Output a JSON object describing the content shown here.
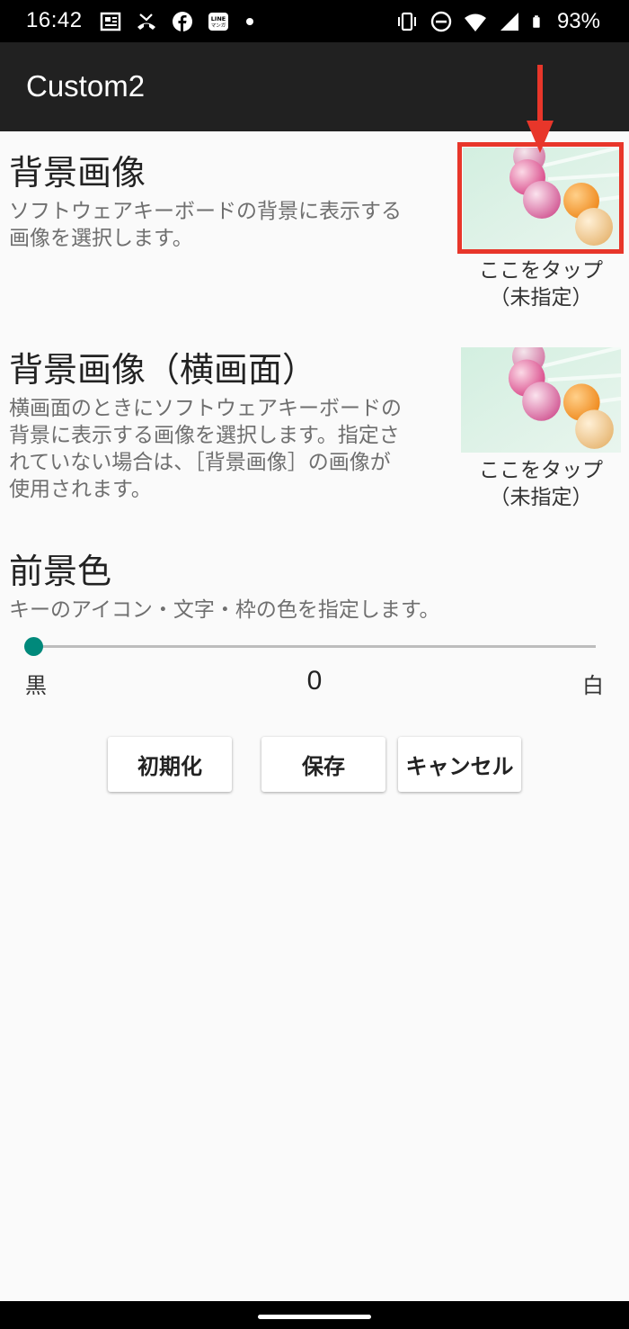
{
  "status_bar": {
    "time": "16:42",
    "left_icons": [
      "news-icon",
      "missed-call-icon",
      "facebook-icon",
      "line-manga-icon",
      "notification-dot-icon"
    ],
    "right_icons": [
      "vibrate-icon",
      "do-not-disturb-icon",
      "wifi-icon",
      "signal-icon",
      "battery-icon"
    ],
    "battery_percent": "93%"
  },
  "app_bar": {
    "title": "Custom2"
  },
  "background_image": {
    "title": "背景画像",
    "summary_line1": "ソフトウェアキーボードの背景に表示する",
    "summary_line2": "画像を選択します。",
    "caption_line1": "ここをタップ",
    "caption_line2": "（未指定）"
  },
  "background_image_landscape": {
    "title": "背景画像（横画面）",
    "summary_line1": "横画面のときにソフトウェアキーボードの",
    "summary_line2": "背景に表示する画像を選択します。指定さ",
    "summary_line3": "れていない場合は、［背景画像］の画像が",
    "summary_line4": "使用されます。",
    "caption_line1": "ここをタップ",
    "caption_line2": "（未指定）"
  },
  "foreground_color": {
    "title": "前景色",
    "summary": "キーのアイコン・文字・枠の色を指定します。",
    "slider": {
      "min_label": "黒",
      "max_label": "白",
      "value": "0",
      "fraction": 0
    }
  },
  "buttons": {
    "reset": "初期化",
    "save": "保存",
    "cancel": "キャンセル"
  },
  "colors": {
    "accent": "#00897b",
    "highlight": "#e8362a",
    "app_bar": "#212121"
  }
}
